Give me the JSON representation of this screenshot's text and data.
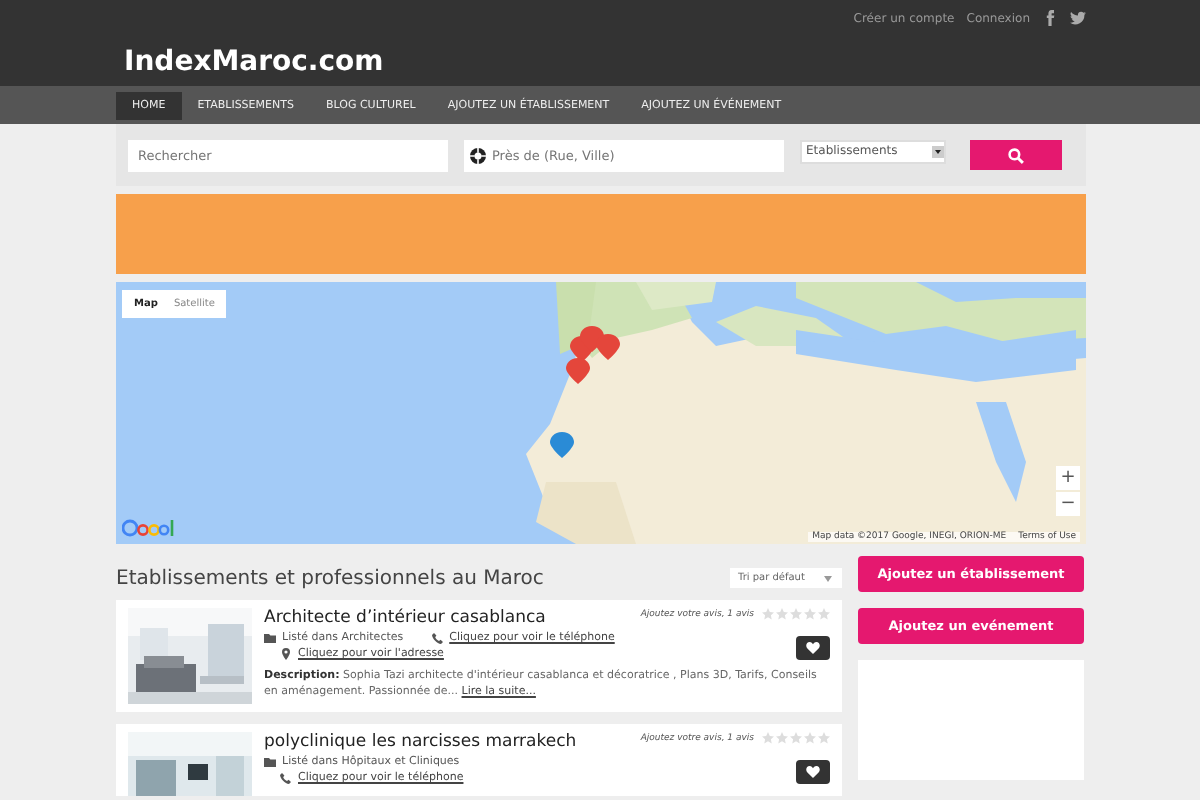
{
  "header": {
    "logo": "IndexMaroc.com",
    "account_links": [
      "Créer un compte",
      "Connexion"
    ]
  },
  "nav": [
    {
      "label": "HOME",
      "selected": true
    },
    {
      "label": "ETABLISSEMENTS",
      "selected": false
    },
    {
      "label": "BLOG CULTUREL",
      "selected": false
    },
    {
      "label": "AJOUTEZ UN ÉTABLISSEMENT",
      "selected": false
    },
    {
      "label": "AJOUTEZ UN ÉVÉNEMENT",
      "selected": false
    }
  ],
  "search": {
    "keyword_placeholder": "Rechercher",
    "location_placeholder": "Près de (Rue, Ville)",
    "category": "Etablissements"
  },
  "map": {
    "kind": "picture",
    "types": [
      {
        "label": "Map",
        "selected": true
      },
      {
        "label": "Satellite",
        "selected": false
      }
    ],
    "zoom": [
      "+",
      "−"
    ],
    "attribution": "Map data ©2017 Google, INEGI, ORION-ME",
    "terms": "Terms of Use"
  },
  "listing": {
    "title": "Etablissements et professionnels au Maroc",
    "sort": "Tri par défaut",
    "items": [
      {
        "name": "Architecte d’intérieur casablanca",
        "reviews": "Ajoutez votre avis, 1 avis",
        "stars": 0,
        "category": "Listé dans Architectes",
        "phone": "Cliquez pour voir le téléphone",
        "address": "Cliquez pour voir l'adresse",
        "description": {
          "label": "Description:",
          "text": "Sophia Tazi architecte d'intérieur casablanca et décoratrice , Plans 3D, Tarifs, Conseils en aménagement. Passionnée de...",
          "more": "Lire la suite..."
        }
      },
      {
        "name": "polyclinique les narcisses marrakech",
        "reviews": "Ajoutez votre avis, 1 avis",
        "stars": 0,
        "category": "Listé dans Hôpitaux et Cliniques",
        "phone": "Cliquez pour voir le téléphone"
      }
    ]
  },
  "sidebar": {
    "buttons": [
      "Ajoutez un établissement",
      "Ajoutez un evénement"
    ]
  }
}
